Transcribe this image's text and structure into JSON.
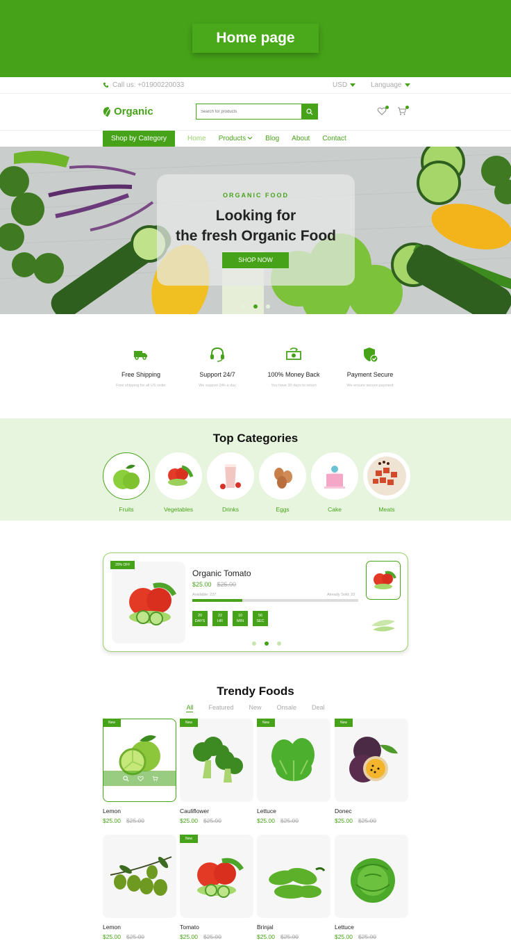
{
  "banner": {
    "title": "Home page"
  },
  "topbar": {
    "phone": "Call us: +01900220033",
    "currency": "USD",
    "language": "Language"
  },
  "header": {
    "logo": "Organic",
    "search_placeholder": "Search for products"
  },
  "nav": {
    "shop_category": "Shop by Category",
    "links": [
      {
        "label": "Home"
      },
      {
        "label": "Products"
      },
      {
        "label": "Blog"
      },
      {
        "label": "About"
      },
      {
        "label": "Contact"
      }
    ]
  },
  "hero": {
    "kicker": "ORGANIC FOOD",
    "line1": "Looking for",
    "line2": "the fresh Organic Food",
    "button": "SHOP NOW",
    "slides": 3,
    "active_slide": 2
  },
  "features": [
    {
      "icon": "truck-icon",
      "title": "Free Shipping",
      "sub": "Free shipping for all US order"
    },
    {
      "icon": "headset-icon",
      "title": "Support 24/7",
      "sub": "We support 24h a day"
    },
    {
      "icon": "money-icon",
      "title": "100% Money Back",
      "sub": "You have 30 days to return"
    },
    {
      "icon": "shield-check-icon",
      "title": "Payment Secure",
      "sub": "We ensure secure payment"
    }
  ],
  "categories": {
    "title": "Top Categories",
    "items": [
      {
        "label": "Fruits",
        "icon": "apple-icon"
      },
      {
        "label": "Vegetables",
        "icon": "vegetables-icon"
      },
      {
        "label": "Drinks",
        "icon": "drink-icon"
      },
      {
        "label": "Eggs",
        "icon": "eggs-icon"
      },
      {
        "label": "Cake",
        "icon": "cake-icon"
      },
      {
        "label": "Meats",
        "icon": "meat-icon"
      }
    ]
  },
  "deal": {
    "badge": "20% OFF",
    "name": "Organic Tomato",
    "price": "$25.00",
    "old_price": "$25.00",
    "available": "Available: 237",
    "sold": "Already Sold: 23",
    "progress": 0.3,
    "countdown": [
      {
        "value": "20",
        "unit": "DAYS"
      },
      {
        "value": "22",
        "unit": "HR"
      },
      {
        "value": "10",
        "unit": "MIN"
      },
      {
        "value": "56",
        "unit": "SEC"
      }
    ]
  },
  "trendy": {
    "title": "Trendy Foods",
    "tabs": [
      "All",
      "Featured",
      "New",
      "Onsale",
      "Deal"
    ],
    "products": [
      {
        "name": "Lemon",
        "price": "$25.00",
        "old": "$25.00",
        "badge": "New",
        "icon": "lime-icon"
      },
      {
        "name": "Cauliflower",
        "price": "$25.00",
        "old": "$25.00",
        "badge": "New",
        "icon": "broccoli-icon"
      },
      {
        "name": "Lettuce",
        "price": "$25.00",
        "old": "$25.00",
        "badge": "New",
        "icon": "spinach-icon"
      },
      {
        "name": "Donec",
        "price": "$25.00",
        "old": "$25.00",
        "badge": "New",
        "icon": "passionfruit-icon"
      },
      {
        "name": "Lemon",
        "price": "$25.00",
        "old": "$25.00",
        "badge": "",
        "icon": "olive-icon"
      },
      {
        "name": "Tomato",
        "price": "$25.00",
        "old": "$25.00",
        "badge": "New",
        "icon": "tomato-icon"
      },
      {
        "name": "Brinjal",
        "price": "$25.00",
        "old": "$25.00",
        "badge": "",
        "icon": "pepper-icon"
      },
      {
        "name": "Lettuce",
        "price": "$25.00",
        "old": "$25.00",
        "badge": "",
        "icon": "lettuce-icon"
      }
    ]
  },
  "colors": {
    "brand": "#46a319",
    "light": "#e8f5de"
  }
}
